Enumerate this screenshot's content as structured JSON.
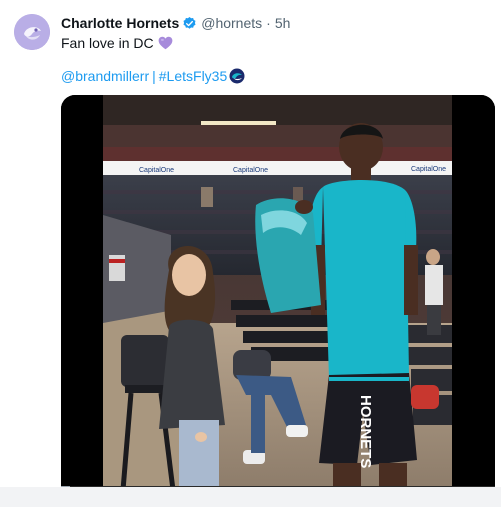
{
  "tweet": {
    "display_name": "Charlotte Hornets",
    "handle": "@hornets",
    "separator": "·",
    "timestamp": "5h",
    "text": "Fan love in DC",
    "links": [
      {
        "text": "@brandmillerr"
      },
      {
        "text": "#LetsFly35"
      }
    ],
    "link_separator": "|"
  },
  "media": {
    "type": "video",
    "jersey_text": "HORNETS",
    "banner_text": "CapitalOne",
    "progress": 0.02
  },
  "icons": {
    "avatar": "hornets-logo-avatar",
    "verified": "verified-badge-icon",
    "heart": "purple-heart-emoji",
    "hashflag": "hornets-hashflag-icon"
  },
  "colors": {
    "link": "#1d9bf0",
    "verified": "#1d9bf0",
    "heart": "#a78bdb",
    "teal": "#19b6c9",
    "text": "#0f1419",
    "secondary_text": "#536471"
  }
}
